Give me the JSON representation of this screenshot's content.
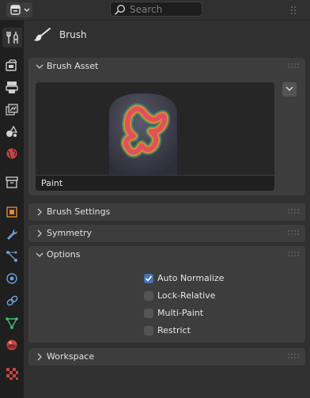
{
  "header": {
    "search_placeholder": "Search"
  },
  "tabs": [
    {
      "icon": "tool-icon",
      "active": true
    },
    {
      "icon": "render-icon"
    },
    {
      "icon": "output-icon"
    },
    {
      "icon": "view-layer-icon"
    },
    {
      "icon": "scene-icon"
    },
    {
      "icon": "world-icon"
    },
    {
      "icon": "collection-icon"
    },
    {
      "icon": "object-icon"
    },
    {
      "icon": "modifier-icon"
    },
    {
      "icon": "particles-icon"
    },
    {
      "icon": "physics-icon"
    },
    {
      "icon": "constraints-icon"
    },
    {
      "icon": "object-data-icon"
    },
    {
      "icon": "material-icon"
    },
    {
      "icon": "texture-icon"
    }
  ],
  "content": {
    "title": "Brush",
    "panels": {
      "brush_asset": {
        "title": "Brush Asset",
        "expanded": true,
        "preview_name": "Paint"
      },
      "brush_settings": {
        "title": "Brush Settings",
        "expanded": false
      },
      "symmetry": {
        "title": "Symmetry",
        "expanded": false
      },
      "options": {
        "title": "Options",
        "expanded": true,
        "checkboxes": [
          {
            "label": "Auto Normalize",
            "checked": true
          },
          {
            "label": "Lock-Relative",
            "checked": false
          },
          {
            "label": "Multi-Paint",
            "checked": false
          },
          {
            "label": "Restrict",
            "checked": false
          }
        ]
      },
      "workspace": {
        "title": "Workspace",
        "expanded": false
      }
    }
  },
  "colors": {
    "accent": "#4772b3",
    "panel_bg": "#3d3d3d",
    "background": "#303030",
    "tab_bar": "#1f1f1f"
  }
}
